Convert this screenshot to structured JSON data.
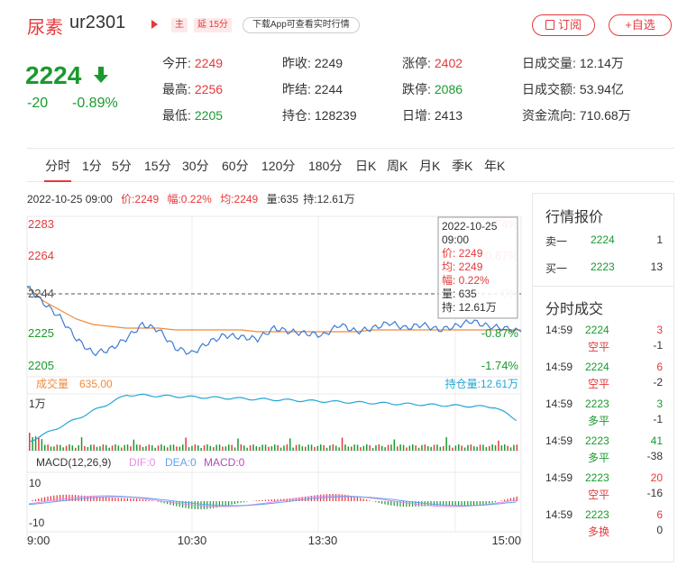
{
  "header": {
    "name": "尿素",
    "code": "ur2301",
    "tag_main": "主",
    "tag_delay": "延 15分",
    "download": "下载App可查看实时行情",
    "subscribe": "订阅",
    "watchlist": "+自选"
  },
  "quote": {
    "price": "2224",
    "change": "-20",
    "change_pct": "-0.89%",
    "stats": [
      {
        "label": "今开:",
        "value": "2249",
        "color": "red"
      },
      {
        "label": "昨收:",
        "value": "2249",
        "color": "normal"
      },
      {
        "label": "涨停:",
        "value": "2402",
        "color": "red"
      },
      {
        "label": "日成交量:",
        "value": "12.14万",
        "color": "normal"
      },
      {
        "label": "最高:",
        "value": "2256",
        "color": "red"
      },
      {
        "label": "昨结:",
        "value": "2244",
        "color": "normal"
      },
      {
        "label": "跌停:",
        "value": "2086",
        "color": "green"
      },
      {
        "label": "日成交额:",
        "value": "53.94亿",
        "color": "normal"
      },
      {
        "label": "最低:",
        "value": "2205",
        "color": "green"
      },
      {
        "label": "持仓:",
        "value": "128239",
        "color": "normal"
      },
      {
        "label": "日增:",
        "value": "2413",
        "color": "normal"
      },
      {
        "label": "资金流向:",
        "value": "710.68万",
        "color": "normal"
      }
    ]
  },
  "tabs": [
    "分时",
    "1分",
    "5分",
    "15分",
    "30分",
    "60分",
    "120分",
    "180分",
    "日K",
    "周K",
    "月K",
    "季K",
    "年K"
  ],
  "info": {
    "datetime": "2022-10-25 09:00",
    "price": "价:2249",
    "range": "幅:0.22%",
    "avg": "均:2249",
    "volume": "量:635",
    "amount": "持:12.61万"
  },
  "tooltip": {
    "date": "2022-10-25",
    "time": "09:00",
    "price": "价: 2249",
    "avg": "均: 2249",
    "range": "幅: 0.22%",
    "volume": "量: 635",
    "position": "持: 12.61万"
  },
  "chart": {
    "y_labels": [
      "2283",
      "2264",
      "2244",
      "2225",
      "2205"
    ],
    "pct_labels": [
      "1.74%",
      "0.87%",
      "0%",
      "-0.87%",
      "-1.74%"
    ],
    "volume_label": "成交量",
    "volume_value": "635.00",
    "position_label": "持仓量:12.61万",
    "volume_axis": "1万",
    "macd_label": "MACD(12,26,9)",
    "dif": "DIF:0",
    "dea": "DEA:0",
    "macd": "MACD:0",
    "macd_top": "10",
    "macd_bottom": "-10",
    "x_labels": [
      "9:00",
      "10:30",
      "13:30",
      "15:00"
    ]
  },
  "chart_data": {
    "type": "line",
    "x": [
      "9:00",
      "10:30",
      "13:30",
      "15:00"
    ],
    "ylim": [
      2205,
      2283
    ],
    "series": [
      {
        "values": [
          2249,
          2240,
          2232,
          2220,
          2212,
          2214,
          2220,
          2228,
          2225,
          2215,
          2212,
          2218,
          2222,
          2221,
          2220,
          2226,
          2224,
          2223,
          2222,
          2228,
          2224,
          2226,
          2229,
          2226,
          2228,
          2225,
          2227,
          2230,
          2227,
          2226,
          2224
        ]
      },
      {
        "values": [
          2249,
          2241,
          2236,
          2231,
          2228,
          2227,
          2226,
          2226,
          2226,
          2225,
          2225,
          2225,
          2225,
          2225,
          2224,
          2224,
          2224,
          2224,
          2224,
          2224,
          2224,
          2225,
          2225,
          2225,
          2225,
          2225,
          2225,
          2225,
          2225,
          2225,
          2225
        ]
      }
    ]
  },
  "right_panel": {
    "quote_title": "行情报价",
    "sell1": {
      "label": "卖一",
      "price": "2224",
      "vol": "1"
    },
    "buy1": {
      "label": "买一",
      "price": "2223",
      "vol": "13"
    },
    "trade_title": "分时成交",
    "trades": [
      {
        "time": "14:59",
        "price": "2224",
        "vol": "3",
        "type": "空平",
        "chg": "-1",
        "type_color": "red"
      },
      {
        "time": "14:59",
        "price": "2224",
        "vol": "6",
        "type": "空平",
        "chg": "-2",
        "type_color": "red"
      },
      {
        "time": "14:59",
        "price": "2223",
        "vol": "3",
        "type": "多平",
        "chg": "-1",
        "type_color": "green"
      },
      {
        "time": "14:59",
        "price": "2223",
        "vol": "41",
        "type": "多平",
        "chg": "-38",
        "type_color": "green"
      },
      {
        "time": "14:59",
        "price": "2223",
        "vol": "20",
        "type": "空平",
        "chg": "-16",
        "type_color": "red"
      },
      {
        "time": "14:59",
        "price": "2223",
        "vol": "6",
        "type": "多换",
        "chg": "0",
        "type_color": "red"
      }
    ]
  }
}
